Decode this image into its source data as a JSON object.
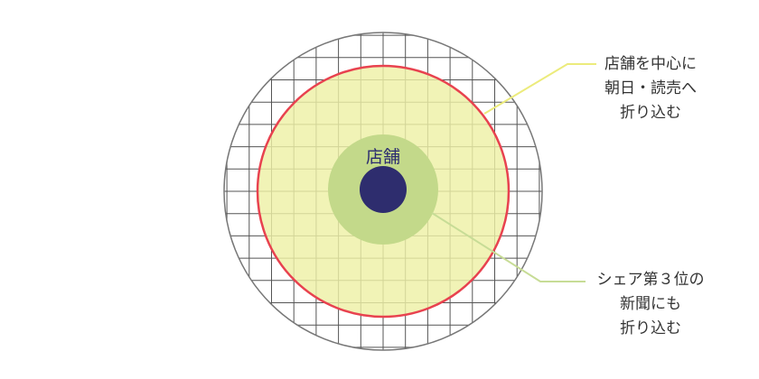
{
  "store_label": "店舗",
  "callouts": {
    "top": {
      "lines": [
        "店舗を中心に",
        "朝日・読売へ",
        "折り込む"
      ]
    },
    "bottom": {
      "lines": [
        "シェア第３位の",
        "新聞にも",
        "折り込む"
      ]
    }
  },
  "colors": {
    "grid_line": "#555555",
    "outer_circle_stroke": "#777777",
    "red_ring": "#e8424f",
    "yellow_fill": "#eef0a6",
    "green_fill": "#c3d98a",
    "store_dot": "#2e2d6e",
    "top_leader": "#eceb7c",
    "bottom_leader": "#c7dc96"
  }
}
